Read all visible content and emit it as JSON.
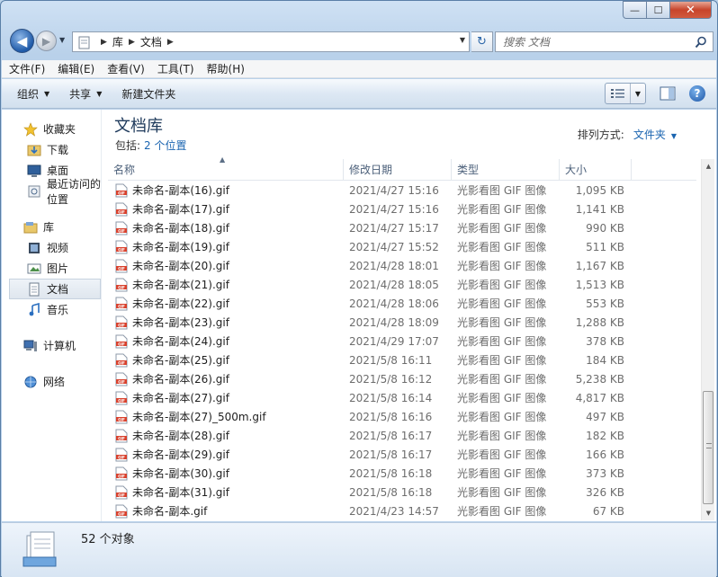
{
  "window": {
    "caption": {
      "min": "—",
      "max": "☐",
      "close": "✕"
    }
  },
  "nav": {
    "back": "◀",
    "forward": "▶",
    "breadcrumb": [
      "库",
      "文档"
    ],
    "search_placeholder": "搜索 文档",
    "refresh": "↻"
  },
  "menu": [
    "文件(F)",
    "编辑(E)",
    "查看(V)",
    "工具(T)",
    "帮助(H)"
  ],
  "toolbar": {
    "organize": "组织",
    "share": "共享",
    "new_folder": "新建文件夹",
    "help": "?"
  },
  "sidebar": {
    "favorites": {
      "label": "收藏夹",
      "items": [
        "下载",
        "桌面",
        "最近访问的位置"
      ]
    },
    "libraries": {
      "label": "库",
      "items": [
        "视频",
        "图片",
        "文档",
        "音乐"
      ]
    },
    "computer": "计算机",
    "network": "网络"
  },
  "library": {
    "title": "文档库",
    "includes_label": "包括:",
    "includes_link": "2 个位置",
    "arrange_label": "排列方式:",
    "arrange_value": "文件夹"
  },
  "columns": {
    "name": "名称",
    "date": "修改日期",
    "type": "类型",
    "size": "大小"
  },
  "files": [
    {
      "name": "未命名-副本(16).gif",
      "date": "2021/4/27 15:16",
      "type": "光影看图 GIF 图像",
      "size": "1,095 KB"
    },
    {
      "name": "未命名-副本(17).gif",
      "date": "2021/4/27 15:16",
      "type": "光影看图 GIF 图像",
      "size": "1,141 KB"
    },
    {
      "name": "未命名-副本(18).gif",
      "date": "2021/4/27 15:17",
      "type": "光影看图 GIF 图像",
      "size": "990 KB"
    },
    {
      "name": "未命名-副本(19).gif",
      "date": "2021/4/27 15:52",
      "type": "光影看图 GIF 图像",
      "size": "511 KB"
    },
    {
      "name": "未命名-副本(20).gif",
      "date": "2021/4/28 18:01",
      "type": "光影看图 GIF 图像",
      "size": "1,167 KB"
    },
    {
      "name": "未命名-副本(21).gif",
      "date": "2021/4/28 18:05",
      "type": "光影看图 GIF 图像",
      "size": "1,513 KB"
    },
    {
      "name": "未命名-副本(22).gif",
      "date": "2021/4/28 18:06",
      "type": "光影看图 GIF 图像",
      "size": "553 KB"
    },
    {
      "name": "未命名-副本(23).gif",
      "date": "2021/4/28 18:09",
      "type": "光影看图 GIF 图像",
      "size": "1,288 KB"
    },
    {
      "name": "未命名-副本(24).gif",
      "date": "2021/4/29 17:07",
      "type": "光影看图 GIF 图像",
      "size": "378 KB"
    },
    {
      "name": "未命名-副本(25).gif",
      "date": "2021/5/8 16:11",
      "type": "光影看图 GIF 图像",
      "size": "184 KB"
    },
    {
      "name": "未命名-副本(26).gif",
      "date": "2021/5/8 16:12",
      "type": "光影看图 GIF 图像",
      "size": "5,238 KB"
    },
    {
      "name": "未命名-副本(27).gif",
      "date": "2021/5/8 16:14",
      "type": "光影看图 GIF 图像",
      "size": "4,817 KB"
    },
    {
      "name": "未命名-副本(27)_500m.gif",
      "date": "2021/5/8 16:16",
      "type": "光影看图 GIF 图像",
      "size": "497 KB"
    },
    {
      "name": "未命名-副本(28).gif",
      "date": "2021/5/8 16:17",
      "type": "光影看图 GIF 图像",
      "size": "182 KB"
    },
    {
      "name": "未命名-副本(29).gif",
      "date": "2021/5/8 16:17",
      "type": "光影看图 GIF 图像",
      "size": "166 KB"
    },
    {
      "name": "未命名-副本(30).gif",
      "date": "2021/5/8 16:18",
      "type": "光影看图 GIF 图像",
      "size": "373 KB"
    },
    {
      "name": "未命名-副本(31).gif",
      "date": "2021/5/8 16:18",
      "type": "光影看图 GIF 图像",
      "size": "326 KB"
    },
    {
      "name": "未命名-副本.gif",
      "date": "2021/4/23 14:57",
      "type": "光影看图 GIF 图像",
      "size": "67 KB"
    }
  ],
  "status": {
    "count": "52 个对象"
  },
  "colors": {
    "accent": "#1a64b0",
    "title": "#1e395b",
    "selection": "#dfe6ee"
  }
}
